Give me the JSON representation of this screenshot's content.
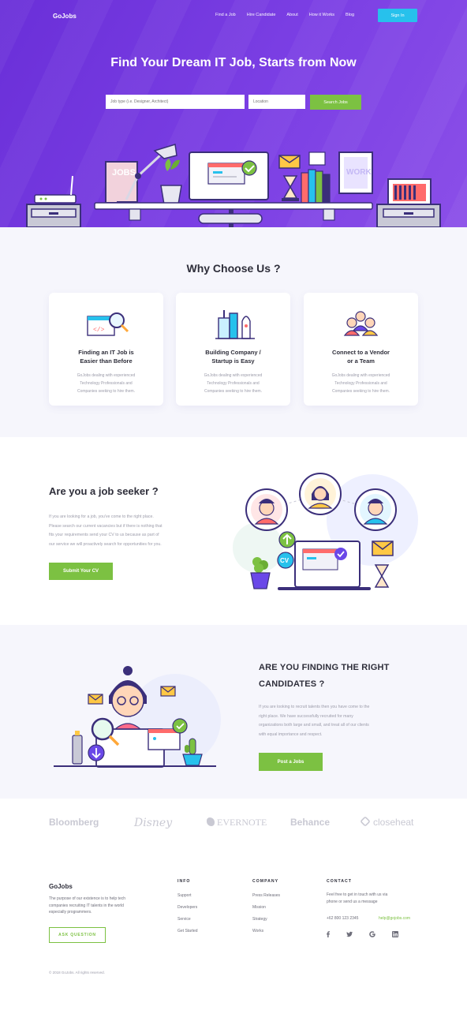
{
  "header": {
    "logo": "GoJobs",
    "nav": [
      "Find a Job",
      "Hire Candidate",
      "About",
      "How it Works",
      "Blog"
    ],
    "signin": "Sign In"
  },
  "hero": {
    "title": "Find Your Dream IT Job, Starts from Now",
    "keyword_placeholder": "Job type (i.e. Designer, Architect)",
    "location_placeholder": "Location",
    "search_button": "Search Jobs",
    "illustration": {
      "book_letters": "JOBS",
      "poster_letters": "WORK"
    }
  },
  "why": {
    "title": "Why Choose Us ?",
    "cards": [
      {
        "icon": "code-browser-search-icon",
        "title_line1": "Finding an IT Job is",
        "title_line2": "Easier than Before",
        "text_line1": "GoJobs dealing with experienced",
        "text_line2": "Technology Professionals and",
        "text_line3": "Companies seeking to hire them."
      },
      {
        "icon": "building-rocket-icon",
        "title_line1": "Building Company /",
        "title_line2": "Startup is Easy",
        "text_line1": "GoJobs dealing with experienced",
        "text_line2": "Technology Professionals and",
        "text_line3": "Companies seeking to hire them."
      },
      {
        "icon": "team-people-icon",
        "title_line1": "Connect to a Vendor",
        "title_line2": "or a Team",
        "text_line1": "GoJobs dealing with experienced",
        "text_line2": "Technology Professionals and",
        "text_line3": "Companies seeking to hire them."
      }
    ]
  },
  "seeker": {
    "title": "Are you a job seeker ?",
    "text_lines": [
      "If you are looking for a job, you've come to the right place.",
      "Please search our current vacancies but if there is nothing that",
      "fits your requirements send your CV to us because as part of",
      "our service we will proactively search for opportunities for you."
    ],
    "button": "Submit Your CV",
    "badge": "CV"
  },
  "recruit": {
    "title_line1": "ARE YOU FINDING THE RIGHT",
    "title_line2": "CANDIDATES ?",
    "text_lines": [
      "If you are looking to recruit talents then you have come to the",
      "right place. We have successfully recruited for many",
      "organizations both large and small, and treat all of our clients",
      "with equal importance and respect."
    ],
    "button": "Post a Jobs"
  },
  "brands": [
    "Bloomberg",
    "Disney",
    "EVERNOTE",
    "Behance",
    "closeheat"
  ],
  "footer": {
    "logo": "GoJobs",
    "about_lines": [
      "The purpose of our existence is to help tech",
      "companies recruiting IT talents in the world",
      "especially programmers."
    ],
    "ask_button": "ASK QUESTION",
    "info": {
      "heading": "INFO",
      "links": [
        "Support",
        "Developers",
        "Service",
        "Get Started"
      ]
    },
    "company": {
      "heading": "COMPANY",
      "links": [
        "Press Releases",
        "Mission",
        "Strategy",
        "Works"
      ]
    },
    "contact": {
      "heading": "CONTACT",
      "text_lines": [
        "Feel free to get in touch with us via",
        "phone or send us a message"
      ],
      "phone": "+62 800 123 2345",
      "email": "help@gojobs.com"
    },
    "social": [
      "facebook-icon",
      "twitter-icon",
      "google-icon",
      "linkedin-icon"
    ],
    "copyright": "© 2018 GoJobs. All rights reserved."
  },
  "colors": {
    "hero": "#7439df",
    "accent_green": "#7cc142",
    "signin_blue": "#27c1ec",
    "section_bg": "#f6f6fc"
  }
}
